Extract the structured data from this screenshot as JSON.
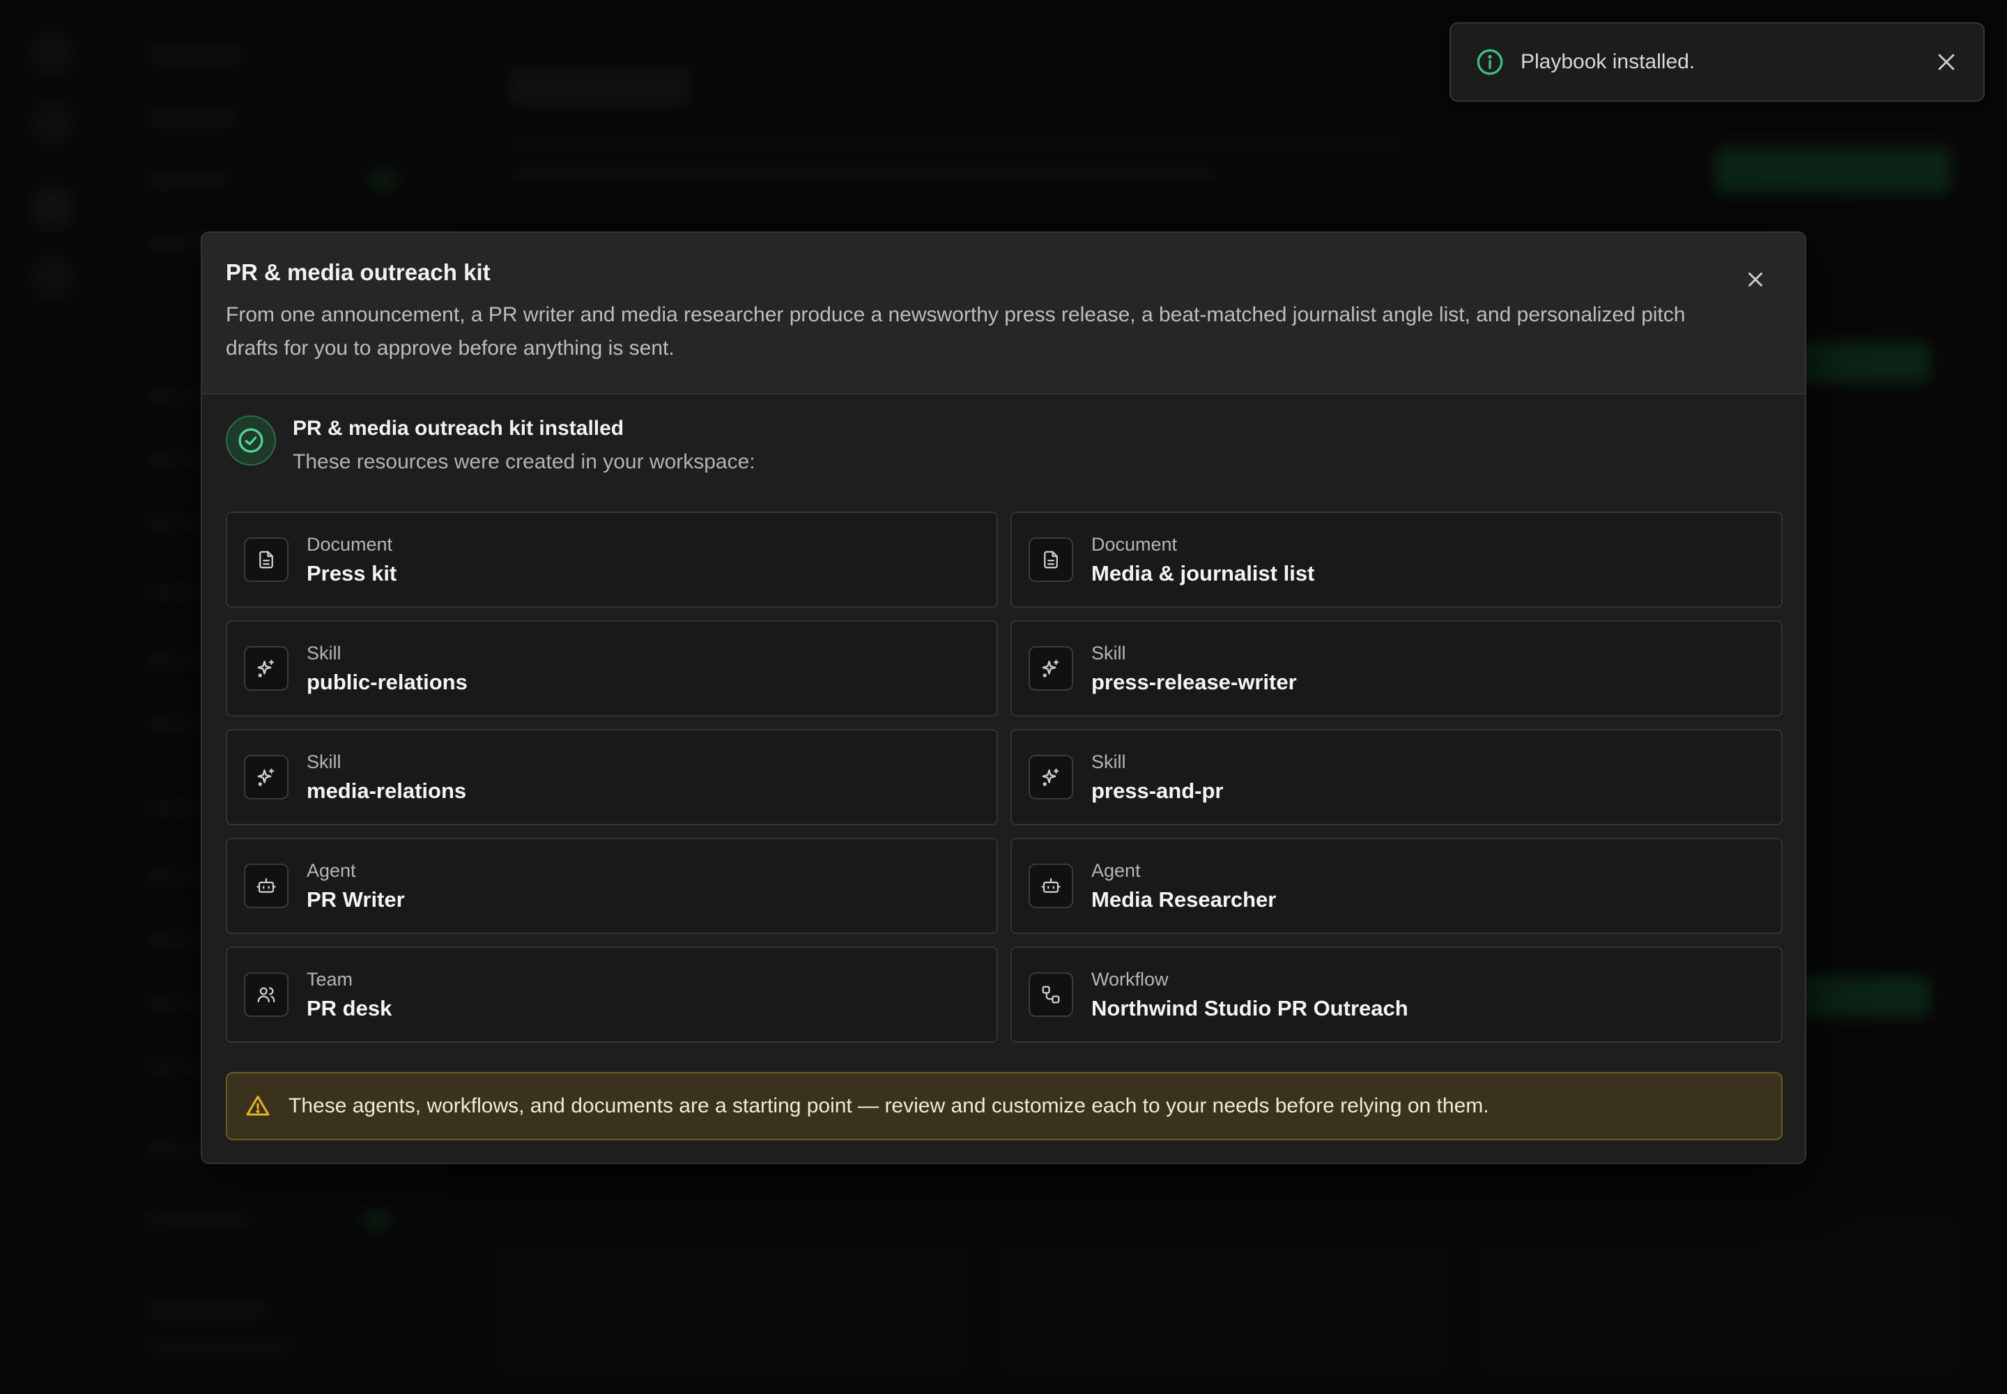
{
  "toast": {
    "message": "Playbook installed.",
    "icon": "info-circle-icon",
    "accent": "#3aa66a"
  },
  "modal": {
    "title": "PR & media outreach kit",
    "description": "From one announcement, a PR writer and media researcher produce a newsworthy press release, a beat-matched journalist angle list, and personalized pitch drafts for you to approve before anything is sent.",
    "installed_title": "PR & media outreach kit installed",
    "installed_subtitle": "These resources were created in your workspace:",
    "resources": [
      {
        "type": "Document",
        "name": "Press kit",
        "icon": "document-icon"
      },
      {
        "type": "Document",
        "name": "Media & journalist list",
        "icon": "document-icon"
      },
      {
        "type": "Skill",
        "name": "public-relations",
        "icon": "sparkles-icon"
      },
      {
        "type": "Skill",
        "name": "press-release-writer",
        "icon": "sparkles-icon"
      },
      {
        "type": "Skill",
        "name": "media-relations",
        "icon": "sparkles-icon"
      },
      {
        "type": "Skill",
        "name": "press-and-pr",
        "icon": "sparkles-icon"
      },
      {
        "type": "Agent",
        "name": "PR Writer",
        "icon": "bot-icon"
      },
      {
        "type": "Agent",
        "name": "Media Researcher",
        "icon": "bot-icon"
      },
      {
        "type": "Team",
        "name": "PR desk",
        "icon": "users-icon"
      },
      {
        "type": "Workflow",
        "name": "Northwind Studio PR Outreach",
        "icon": "workflow-icon"
      }
    ],
    "warning": "These agents, workflows, and documents are a starting point — review and customize each to your needs before relying on them.",
    "warning_color": "#e6b422",
    "success_color": "#3fbf7f"
  }
}
